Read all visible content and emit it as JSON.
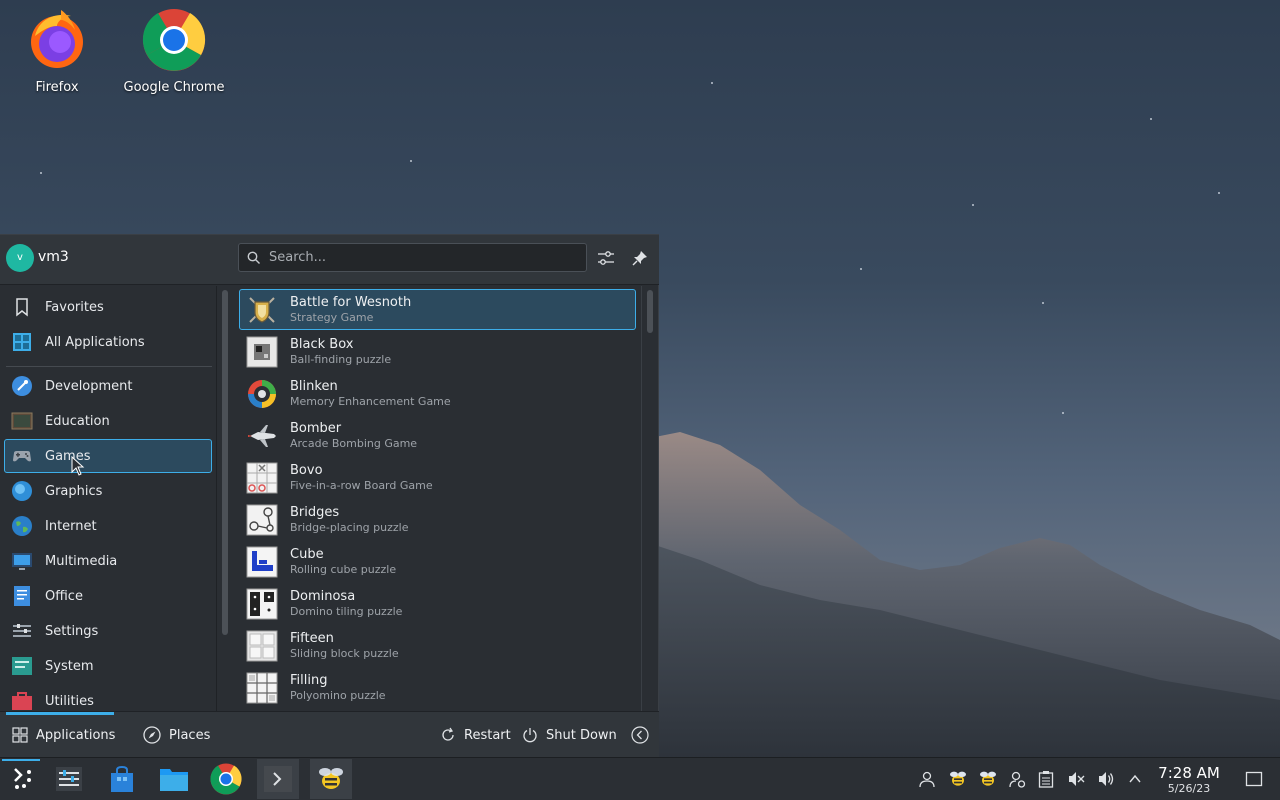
{
  "desktop": {
    "icons": [
      {
        "label": "Firefox",
        "icon": "firefox-icon"
      },
      {
        "label": "Google Chrome",
        "icon": "chrome-icon"
      }
    ]
  },
  "launcher": {
    "user": {
      "name": "vm3",
      "avatar_initial": "v"
    },
    "search": {
      "placeholder": "Search..."
    },
    "categories": [
      {
        "label": "Favorites",
        "icon": "bookmark-icon"
      },
      {
        "label": "All Applications",
        "icon": "grid-icon"
      },
      {
        "label": "Development",
        "icon": "development-icon"
      },
      {
        "label": "Education",
        "icon": "education-icon"
      },
      {
        "label": "Games",
        "icon": "gamepad-icon",
        "selected": true
      },
      {
        "label": "Graphics",
        "icon": "graphics-icon"
      },
      {
        "label": "Internet",
        "icon": "globe-icon"
      },
      {
        "label": "Multimedia",
        "icon": "multimedia-icon"
      },
      {
        "label": "Office",
        "icon": "office-icon"
      },
      {
        "label": "Settings",
        "icon": "settings-icon"
      },
      {
        "label": "System",
        "icon": "system-icon"
      },
      {
        "label": "Utilities",
        "icon": "utilities-icon"
      }
    ],
    "apps": [
      {
        "name": "Battle for Wesnoth",
        "desc": "Strategy Game",
        "selected": true
      },
      {
        "name": "Black Box",
        "desc": "Ball-finding puzzle"
      },
      {
        "name": "Blinken",
        "desc": "Memory Enhancement Game"
      },
      {
        "name": "Bomber",
        "desc": "Arcade Bombing Game"
      },
      {
        "name": "Bovo",
        "desc": "Five-in-a-row Board Game"
      },
      {
        "name": "Bridges",
        "desc": "Bridge-placing puzzle"
      },
      {
        "name": "Cube",
        "desc": "Rolling cube puzzle"
      },
      {
        "name": "Dominosa",
        "desc": "Domino tiling puzzle"
      },
      {
        "name": "Fifteen",
        "desc": "Sliding block puzzle"
      },
      {
        "name": "Filling",
        "desc": "Polyomino puzzle"
      }
    ],
    "footer": {
      "applications_label": "Applications",
      "places_label": "Places",
      "restart_label": "Restart",
      "shutdown_label": "Shut Down"
    }
  },
  "taskbar": {
    "clock": {
      "time": "7:28 AM",
      "date": "5/26/23"
    }
  },
  "colors": {
    "accent": "#3daee9",
    "selection_bg": "#2c4a5e",
    "panel_bg": "#2a2e33"
  }
}
